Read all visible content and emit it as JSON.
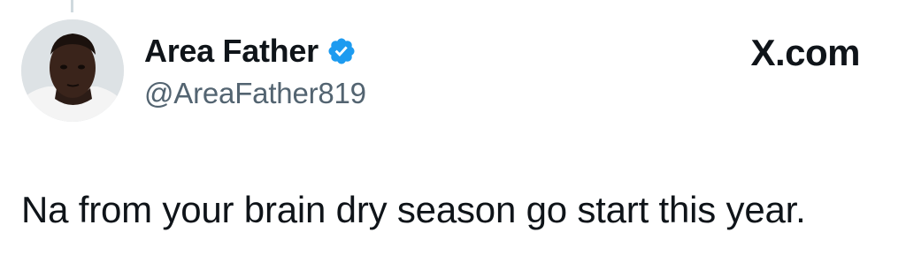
{
  "author": {
    "display_name": "Area Father",
    "handle": "@AreaFather819",
    "verified": true,
    "avatar": "profile-photo"
  },
  "brand": {
    "label": "X.com"
  },
  "tweet": {
    "text": "Na from your brain dry season go start this year."
  },
  "colors": {
    "verified_badge": "#1d9bf0",
    "handle_text": "#536471",
    "main_text": "#0f1419",
    "thread_line": "#cfd9de"
  }
}
